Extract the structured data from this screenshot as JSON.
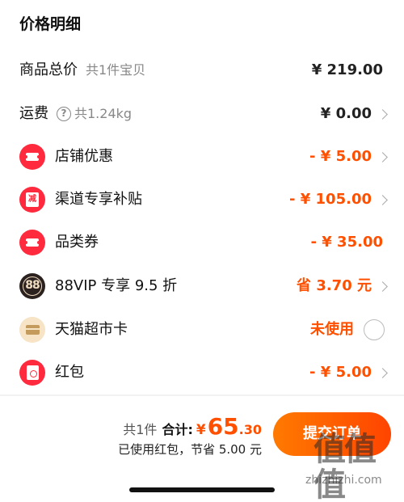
{
  "header": {
    "title": "价格明细"
  },
  "rows": {
    "goods_total": {
      "label": "商品总价",
      "sub": "共1件宝贝",
      "value": "¥ 219.00"
    },
    "shipping": {
      "label": "运费",
      "help_glyph": "?",
      "sub": "共1.24kg",
      "value": "¥ 0.00"
    },
    "shop_discount": {
      "label": "店铺优惠",
      "value": "- ¥ 5.00",
      "icon": "coupon-ticket-icon"
    },
    "channel_subsidy": {
      "label": "渠道专享补贴",
      "value": "- ¥ 105.00",
      "icon_text": "减",
      "icon": "subsidy-icon"
    },
    "category_coupon": {
      "label": "品类券",
      "value": "- ¥ 35.00",
      "icon": "coupon-ticket-icon"
    },
    "vip": {
      "label": "88VIP 专享 9.5 折",
      "value": "省 3.70 元",
      "icon_text": "88",
      "icon": "vip-88-icon"
    },
    "tmall_card": {
      "label": "天猫超市卡",
      "value": "未使用",
      "icon": "card-icon"
    },
    "red_packet": {
      "label": "红包",
      "value": "- ¥ 5.00",
      "icon": "red-envelope-icon"
    }
  },
  "footer": {
    "count": "共1件",
    "total_label": "合计:",
    "currency": "¥",
    "total_int": "65",
    "total_dec": ".30",
    "saved_text": "已使用红包，节省 5.00 元",
    "submit_label": "提交订单"
  },
  "watermark": {
    "glyphs": "值值值",
    "url": "zhizhizhi.com"
  },
  "colors": {
    "accent": "#ff5000",
    "icon_red": "#ff2a3d",
    "submit_gradient_start": "#ff7a00",
    "submit_gradient_end": "#ff4400"
  }
}
